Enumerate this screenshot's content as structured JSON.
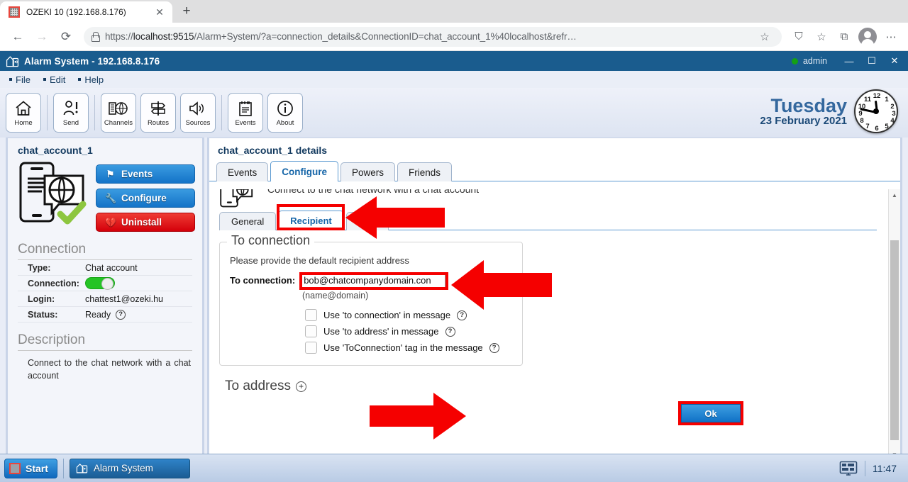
{
  "browser": {
    "tab": {
      "title": "OZEKI 10 (192.168.8.176)",
      "favicon": "ozeki-favicon",
      "close_label": "✕"
    },
    "newtab_label": "+",
    "back_label": "←",
    "forward_label": "→",
    "reload_label": "⟳",
    "url_scheme": "https://",
    "url_host": "localhost:9515",
    "url_path": "/Alarm+System/?a=connection_details&ConnectionID=chat_account_1%40localhost&refr…",
    "bookmark_label": "☆",
    "shield_label": "⛉",
    "favorite_label": "☆",
    "collections_label": "⧉",
    "more_label": "⋯"
  },
  "app": {
    "title": "Alarm System - 192.168.8.176",
    "user": "admin",
    "minimize_label": "—",
    "maximize_label": "☐",
    "close_label": "✕",
    "menus": [
      "File",
      "Edit",
      "Help"
    ],
    "toolbar": [
      {
        "label": "Home",
        "icon": "home-icon"
      },
      {
        "label": "Send",
        "icon": "send-person-icon"
      },
      {
        "label": "Channels",
        "icon": "channels-icon"
      },
      {
        "label": "Routes",
        "icon": "routes-icon"
      },
      {
        "label": "Sources",
        "icon": "sources-speaker-icon"
      },
      {
        "label": "Events",
        "icon": "events-notepad-icon"
      },
      {
        "label": "About",
        "icon": "about-info-icon"
      }
    ],
    "date": {
      "day": "Tuesday",
      "full": "23 February 2021"
    },
    "clock": {
      "time": "11:47"
    }
  },
  "sidebar": {
    "title": "chat_account_1",
    "icon": "chat-account-icon",
    "buttons": [
      {
        "label": "Events",
        "icon": "flag-icon",
        "color": "#1473c8"
      },
      {
        "label": "Configure",
        "icon": "wrench-icon",
        "color": "#1473c8"
      },
      {
        "label": "Uninstall",
        "icon": "broken-heart-icon",
        "color": "#d4000a"
      }
    ],
    "connection_section": "Connection",
    "rows": [
      {
        "key": "Type:",
        "value": "Chat account"
      },
      {
        "key": "Connection:",
        "value": "",
        "control": "toggle-on"
      },
      {
        "key": "Login:",
        "value": "chattest1@ozeki.hu"
      },
      {
        "key": "Status:",
        "value": "Ready",
        "help": "?"
      }
    ],
    "description_section": "Description",
    "description": "Connect to the chat network with a chat account"
  },
  "main": {
    "title": "chat_account_1 details",
    "outer_tabs": [
      {
        "label": "Events",
        "active": false
      },
      {
        "label": "Configure",
        "active": true
      },
      {
        "label": "Powers",
        "active": false
      },
      {
        "label": "Friends",
        "active": false
      }
    ],
    "header_icon": "chat-account-icon",
    "header_desc": "Connect to the chat network with a chat account",
    "inner_tabs": [
      {
        "label": "General",
        "active": false
      },
      {
        "label": "Recipient",
        "active": true
      },
      {
        "label": "",
        "active": false
      }
    ],
    "fieldset": {
      "legend": "To connection",
      "hint": "Please provide the default recipient address",
      "field_label": "To connection:",
      "field_value": "bob@chatcompanydomain.con",
      "field_placeholder": "name@domain",
      "sub_note": "(name@domain)",
      "checkboxes": [
        {
          "label": "Use 'to connection' in message",
          "checked": false,
          "help": "?"
        },
        {
          "label": "Use 'to address' in message",
          "checked": false,
          "help": "?"
        },
        {
          "label": "Use 'ToConnection' tag in the message",
          "checked": false,
          "help": "?"
        }
      ]
    },
    "to_address_label": "To address",
    "to_address_plus": "+",
    "ok_label": "Ok",
    "scrollbar": {
      "up": "▲",
      "down": "▼"
    }
  },
  "annotations": {
    "color": "#f50000",
    "arrows": [
      {
        "name": "arrow-to-recipient-tab",
        "direction": "left"
      },
      {
        "name": "arrow-to-connection-input",
        "direction": "left"
      },
      {
        "name": "arrow-to-ok-button",
        "direction": "right"
      }
    ],
    "highlight_boxes": [
      {
        "name": "recipient-tab-highlight"
      },
      {
        "name": "to-connection-input-highlight"
      },
      {
        "name": "ok-button-highlight"
      }
    ]
  },
  "taskbar": {
    "start_label": "Start",
    "items": [
      {
        "label": "Alarm System",
        "icon": "alarm-system-icon"
      }
    ],
    "tray_icon": "display-icon",
    "time": "11:47"
  }
}
